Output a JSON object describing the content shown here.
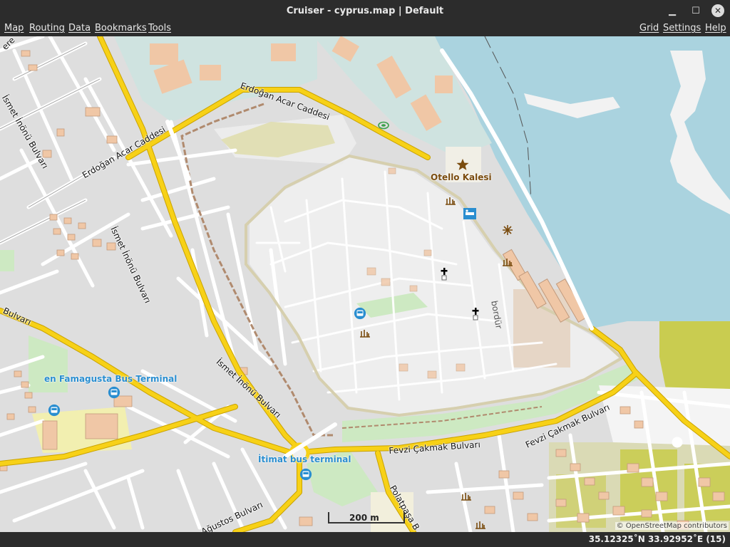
{
  "window": {
    "title": "Cruiser - cyprus.map | Default"
  },
  "menu": {
    "map": "Map",
    "routing": "Routing",
    "data": "Data",
    "bookmarks": "Bookmarks",
    "tools": "Tools",
    "grid": "Grid",
    "settings": "Settings",
    "help": "Help"
  },
  "map": {
    "streets": {
      "erdogan_1": "Erdoğan Acar Caddesi",
      "erdogan_2": "Erdoğan Acar Caddesi",
      "inonu_1": "İsmet İnönü Bulvarı",
      "inonu_2": "İsmet İnönü Bulvarı",
      "inonu_3": "İsmet İnönü Bulvarı",
      "bulvari_left": "Bulvarı",
      "fevzi_1": "Fevzi Çakmak Bulvarı",
      "fevzi_2": "Fevzi Çakmak Bulvarı",
      "polatpasa": "Polatpaşa B",
      "agustos": "Ağustos Bulvarı",
      "bordur": "bordür",
      "top_left": "ere"
    },
    "pois": {
      "castle": "Otello Kalesi",
      "bus_terminal_1": "en Famagusta Bus Terminal",
      "bus_terminal_2": "İtimat bus terminal"
    },
    "scale_label": "200 m",
    "attribution": "© OpenStreetMap contributors"
  },
  "status": {
    "coords": "35.12325˚N 33.92952˚E (15)"
  },
  "colors": {
    "sea": "#aad3df",
    "major_road": "#f7d117",
    "residential": "#e0dfdf",
    "old_city": "#eeeeee",
    "building": "#f0c7a6",
    "park": "#cde9c2",
    "farm": "#c9cc50",
    "commercial": "#f2efdc"
  },
  "icons": {
    "castle": "star-icon",
    "bus": "bus-stop-icon",
    "church": "church-icon",
    "ruins": "ruins-icon",
    "stadium": "stadium-icon",
    "hotel": "hotel-icon",
    "viewpoint": "viewpoint-icon"
  }
}
